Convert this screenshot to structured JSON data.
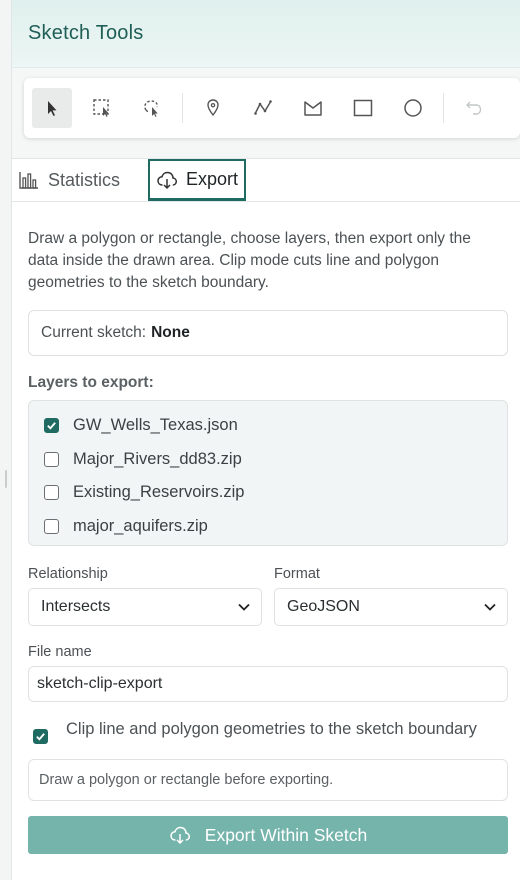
{
  "header": {
    "title": "Sketch Tools"
  },
  "toolbar": {
    "tools": [
      {
        "name": "select-tool",
        "icon": "cursor-arrow-icon",
        "active": true
      },
      {
        "name": "rectangle-select-tool",
        "icon": "rectangle-select-icon"
      },
      {
        "name": "lasso-select-tool",
        "icon": "lasso-select-icon"
      },
      {
        "name": "point-tool",
        "icon": "map-pin-icon"
      },
      {
        "name": "polyline-tool",
        "icon": "polyline-icon"
      },
      {
        "name": "polygon-tool",
        "icon": "polygon-icon"
      },
      {
        "name": "rectangle-tool",
        "icon": "rectangle-icon"
      },
      {
        "name": "circle-tool",
        "icon": "circle-icon"
      },
      {
        "name": "undo-tool",
        "icon": "undo-icon",
        "disabled": true
      }
    ]
  },
  "tabs": [
    {
      "label": "Statistics",
      "icon": "bar-chart-icon",
      "active": false
    },
    {
      "label": "Export",
      "icon": "cloud-download-icon",
      "active": true
    }
  ],
  "export": {
    "description": "Draw a polygon or rectangle, choose layers, then export only the data inside the drawn area. Clip mode cuts line and polygon geometries to the sketch boundary.",
    "current_sketch_label": "Current sketch:",
    "current_sketch_value": "None",
    "layers_label": "Layers to export:",
    "layers": [
      {
        "name": "GW_Wells_Texas.json",
        "checked": true
      },
      {
        "name": "Major_Rivers_dd83.zip",
        "checked": false
      },
      {
        "name": "Existing_Reservoirs.zip",
        "checked": false
      },
      {
        "name": "major_aquifers.zip",
        "checked": false
      }
    ],
    "relationship_label": "Relationship",
    "relationship_value": "Intersects",
    "format_label": "Format",
    "format_value": "GeoJSON",
    "file_name_label": "File name",
    "file_name_value": "sketch-clip-export",
    "clip_checked": true,
    "clip_label": "Clip line and polygon geometries to the sketch boundary",
    "notice": "Draw a polygon or rectangle before exporting.",
    "export_button": "Export Within Sketch"
  },
  "colors": {
    "accent": "#1f6b62",
    "header_bg": "#e6f3f1",
    "button_bg": "#75b4ab"
  }
}
